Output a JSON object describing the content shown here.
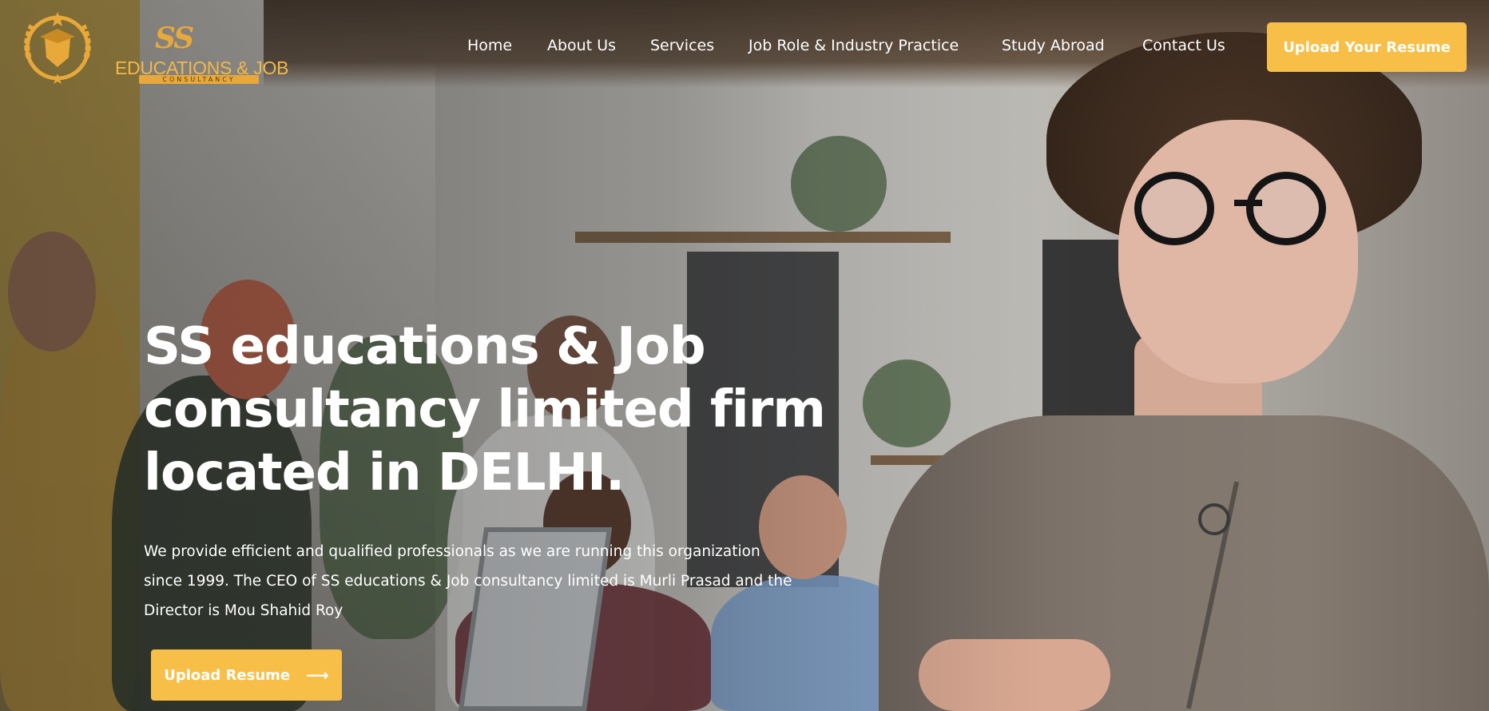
{
  "brand": {
    "logo_mark": "SS",
    "logo_main": "EDUCATIONS & JOB",
    "logo_sub": "CONSULTANCY",
    "accent_color": "#f7bf48"
  },
  "nav": {
    "items": [
      {
        "label": "Home"
      },
      {
        "label": "About Us"
      },
      {
        "label": "Services"
      },
      {
        "label": "Job Role & Industry Practice"
      },
      {
        "label": "Study Abroad"
      },
      {
        "label": "Contact Us"
      }
    ],
    "cta_label": "Upload Your Resume"
  },
  "hero": {
    "title_line1": "SS educations & Job",
    "title_line2": "consultancy limited firm",
    "title_line3": "located in DELHI.",
    "desc_line1": "We provide efficient and qualified professionals as we are running this organization",
    "desc_line2": "since 1999. The CEO of SS educations & Job consultancy limited is Murli Prasad and the",
    "desc_line3": "Director is Mou Shahid Roy",
    "button_label": "Upload Resume",
    "button_icon": "arrow-right-icon"
  }
}
